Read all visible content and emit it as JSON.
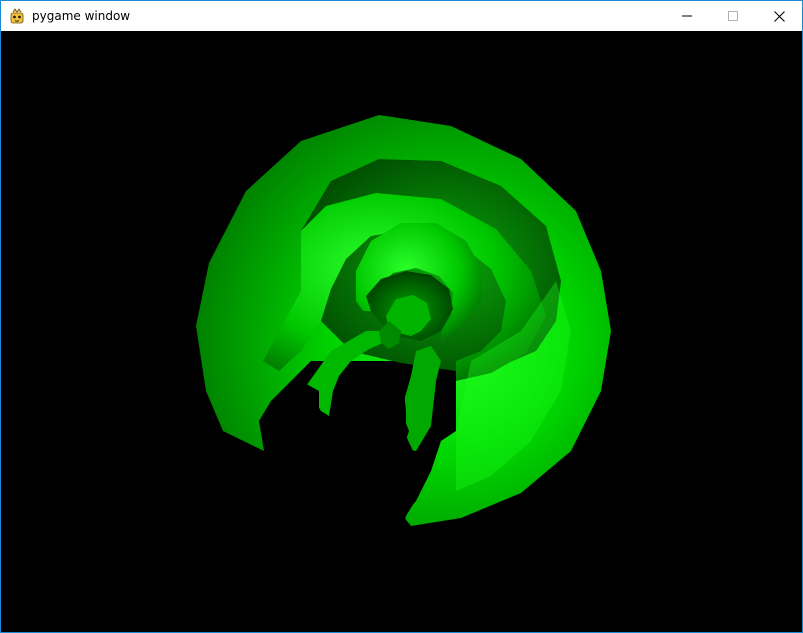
{
  "window": {
    "title": "pygame window",
    "icon": "pygame-snake-icon",
    "controls": {
      "minimize_icon": "minimize-icon",
      "maximize_icon": "maximize-icon",
      "close_icon": "close-icon"
    }
  },
  "scene": {
    "background_color": "#000000",
    "object_color": "#00cc00",
    "shadow_color": "#005a00",
    "highlight_color": "#33ff33"
  }
}
